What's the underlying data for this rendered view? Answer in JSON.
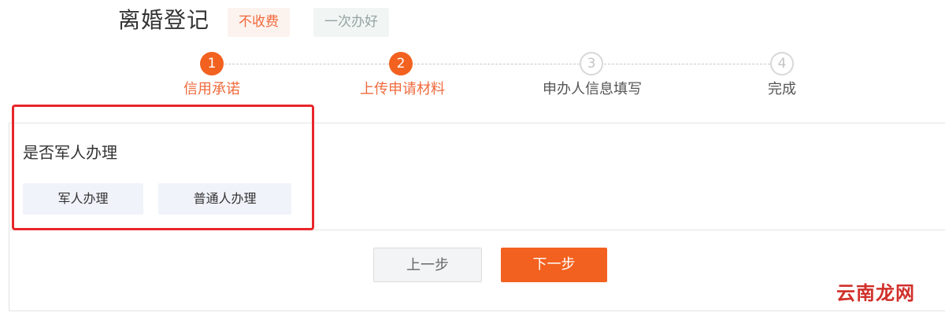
{
  "header": {
    "title": "离婚登记",
    "tags": [
      "不收费",
      "一次办好"
    ]
  },
  "steps": [
    {
      "number": "1",
      "label": "信用承诺",
      "state": "active"
    },
    {
      "number": "2",
      "label": "上传申请材料",
      "state": "active"
    },
    {
      "number": "3",
      "label": "申办人信息填写",
      "state": "inactive"
    },
    {
      "number": "4",
      "label": "完成",
      "state": "inactive"
    }
  ],
  "section": {
    "title": "是否军人办理",
    "options": [
      "军人办理",
      "普通人办理"
    ]
  },
  "actions": {
    "prev_label": "上一步",
    "next_label": "下一步"
  },
  "watermark": "云南龙网",
  "colors": {
    "accent": "#f2611f",
    "highlight_box": "#e8262b",
    "option_bg": "#f0f3fa"
  }
}
